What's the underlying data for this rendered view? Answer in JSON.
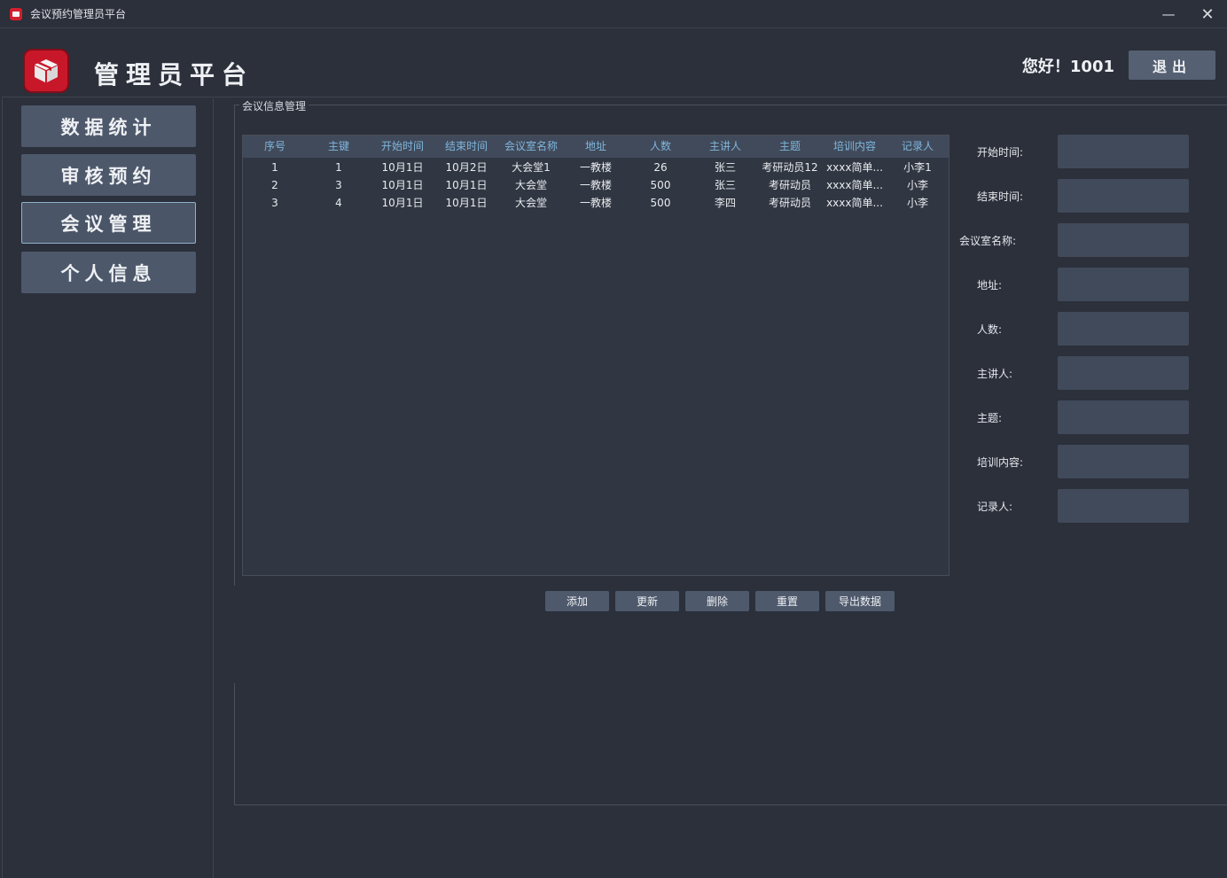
{
  "window": {
    "title": "会议预约管理员平台",
    "minimize": "—",
    "close": "✕"
  },
  "header": {
    "title": "管理员平台",
    "greeting": "您好！1001",
    "logout_label": "退出",
    "logo_icon": "box-icon",
    "accent_color": "#c9172a"
  },
  "sidebar": {
    "items": [
      {
        "label": "数据统计"
      },
      {
        "label": "审核预约"
      },
      {
        "label": "会议管理",
        "active": true
      },
      {
        "label": "个人信息"
      }
    ]
  },
  "main": {
    "group_title": "会议信息管理",
    "table": {
      "columns": [
        "序号",
        "主键",
        "开始时间",
        "结束时间",
        "会议室名称",
        "地址",
        "人数",
        "主讲人",
        "主题",
        "培训内容",
        "记录人"
      ],
      "rows": [
        [
          "1",
          "1",
          "10月1日",
          "10月2日",
          "大会堂1",
          "一教楼",
          "26",
          "张三",
          "考研动员12",
          "xxxx简单...",
          "小李1"
        ],
        [
          "2",
          "3",
          "10月1日",
          "10月1日",
          "大会堂",
          "一教楼",
          "500",
          "张三",
          "考研动员",
          "xxxx简单...",
          "小李"
        ],
        [
          "3",
          "4",
          "10月1日",
          "10月1日",
          "大会堂",
          "一教楼",
          "500",
          "李四",
          "考研动员",
          "xxxx简单...",
          "小李"
        ]
      ]
    },
    "actions": {
      "add": "添加",
      "update": "更新",
      "delete": "删除",
      "reset": "重置",
      "export": "导出数据"
    }
  },
  "form": {
    "fields": [
      {
        "label": "开始时间:",
        "value": ""
      },
      {
        "label": "结束时间:",
        "value": ""
      },
      {
        "label": "会议室名称:",
        "value": ""
      },
      {
        "label": "地址:",
        "value": ""
      },
      {
        "label": "人数:",
        "value": ""
      },
      {
        "label": "主讲人:",
        "value": ""
      },
      {
        "label": "主题:",
        "value": ""
      },
      {
        "label": "培训内容:",
        "value": ""
      },
      {
        "label": "记录人:",
        "value": ""
      }
    ]
  }
}
